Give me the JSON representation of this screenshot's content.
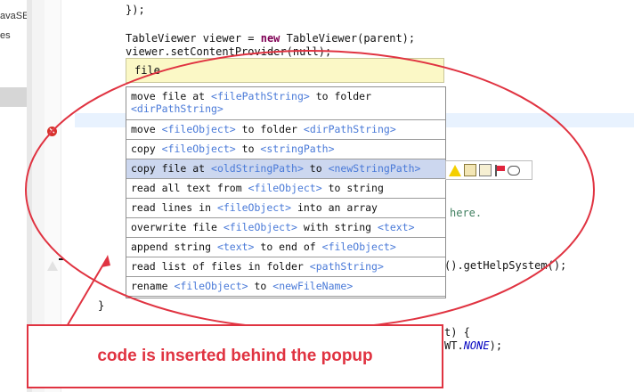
{
  "left_panel": {
    "texts": [
      "avaSE-",
      "es"
    ]
  },
  "code": {
    "line_brace_close": "});",
    "line_viewer": "TableViewer viewer = new TableViewer(parent);",
    "line_viewer_kw": "new",
    "line_content": "viewer.setContentProvider(null);",
    "line_here": "here.",
    "line_helpsystem": "().getHelpSystem();",
    "line_t_brace": "t) {",
    "line_wt_prefix": "WT.",
    "line_wt_const": "NONE",
    "line_wt_suffix": ");",
    "line_close": "}"
  },
  "gutter": {
    "error_icon": "error-x-icon",
    "warning_icon": "warning-triangle-icon"
  },
  "popup": {
    "filter_text": "file",
    "selected_index": 3,
    "items": [
      {
        "parts": [
          {
            "t": "move file at ",
            "ph": false
          },
          {
            "t": "<filePathString>",
            "ph": true
          },
          {
            "t": " to folder",
            "ph": false
          }
        ],
        "line2": [
          {
            "t": "<dirPathString>",
            "ph": true
          }
        ]
      },
      {
        "parts": [
          {
            "t": "move ",
            "ph": false
          },
          {
            "t": "<fileObject>",
            "ph": true
          },
          {
            "t": " to folder ",
            "ph": false
          },
          {
            "t": "<dirPathString>",
            "ph": true
          }
        ]
      },
      {
        "parts": [
          {
            "t": "copy ",
            "ph": false
          },
          {
            "t": "<fileObject>",
            "ph": true
          },
          {
            "t": " to ",
            "ph": false
          },
          {
            "t": "<stringPath>",
            "ph": true
          }
        ]
      },
      {
        "parts": [
          {
            "t": "copy file at ",
            "ph": false
          },
          {
            "t": "<oldStringPath>",
            "ph": true
          },
          {
            "t": " to ",
            "ph": false
          },
          {
            "t": "<newStringPath>",
            "ph": true
          }
        ]
      },
      {
        "parts": [
          {
            "t": "read all text from ",
            "ph": false
          },
          {
            "t": "<fileObject>",
            "ph": true
          },
          {
            "t": " to string",
            "ph": false
          }
        ]
      },
      {
        "parts": [
          {
            "t": "read lines in ",
            "ph": false
          },
          {
            "t": "<fileObject>",
            "ph": true
          },
          {
            "t": " into an array",
            "ph": false
          }
        ]
      },
      {
        "parts": [
          {
            "t": "overwrite file ",
            "ph": false
          },
          {
            "t": "<fileObject>",
            "ph": true
          },
          {
            "t": " with string ",
            "ph": false
          },
          {
            "t": "<text>",
            "ph": true
          }
        ]
      },
      {
        "parts": [
          {
            "t": "append string ",
            "ph": false
          },
          {
            "t": "<text>",
            "ph": true
          },
          {
            "t": " to end of ",
            "ph": false
          },
          {
            "t": "<fileObject>",
            "ph": true
          }
        ]
      },
      {
        "parts": [
          {
            "t": "read list of files in folder ",
            "ph": false
          },
          {
            "t": "<pathString>",
            "ph": true
          }
        ]
      },
      {
        "parts": [
          {
            "t": "rename ",
            "ph": false
          },
          {
            "t": "<fileObject>",
            "ph": true
          },
          {
            "t": " to ",
            "ph": false
          },
          {
            "t": "<newFileName>",
            "ph": true
          }
        ]
      }
    ],
    "status_icons": [
      "warning-icon",
      "note-list-icon",
      "document-list-icon",
      "flag-icon",
      "speech-bubble-icon"
    ]
  },
  "annotation": {
    "callout_text": "code is inserted behind the popup",
    "color": "#e03341"
  },
  "colors": {
    "placeholder": "#4a7ad8",
    "filter_bg": "#fbf8c6",
    "selected_row": "#ccd7ef"
  }
}
